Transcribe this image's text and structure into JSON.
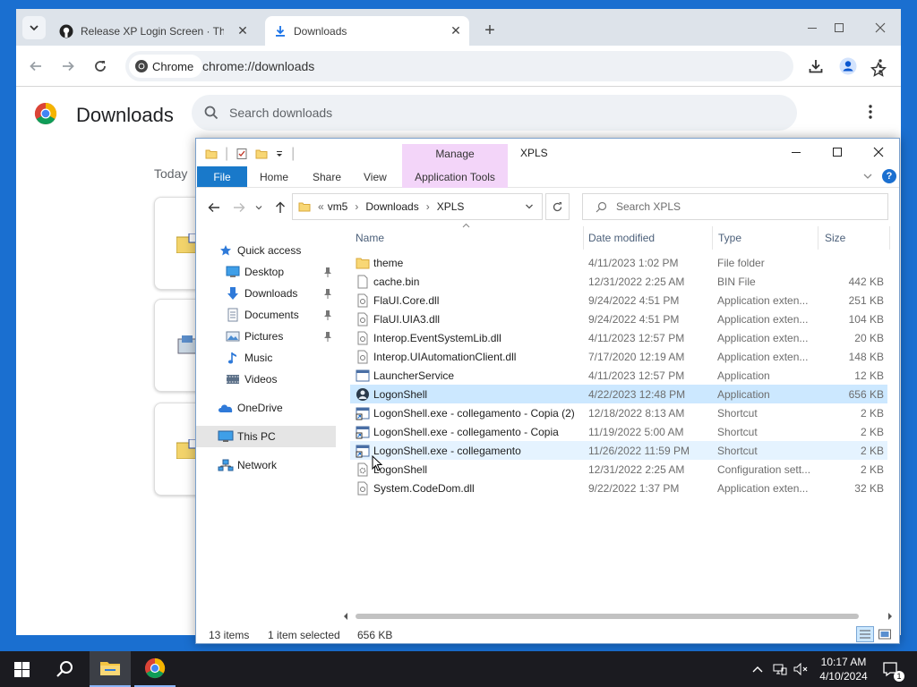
{
  "chrome": {
    "tabs": [
      {
        "title": "Release XP Login Screen · TheR"
      },
      {
        "title": "Downloads"
      }
    ],
    "omnibox": {
      "chip": "Chrome",
      "url": "chrome://downloads"
    },
    "page": {
      "title": "Downloads",
      "search_placeholder": "Search downloads",
      "section": "Today"
    }
  },
  "explorer": {
    "title": "XPLS",
    "contextual_tab": "Manage",
    "ribbon_tabs": [
      "File",
      "Home",
      "Share",
      "View",
      "Application Tools"
    ],
    "breadcrumb": [
      "vm5",
      "Downloads",
      "XPLS"
    ],
    "search_placeholder": "Search XPLS",
    "nav": [
      {
        "label": "Quick access",
        "icon": "star-icon"
      },
      {
        "label": "Desktop",
        "icon": "desktop-icon",
        "pinned": true
      },
      {
        "label": "Downloads",
        "icon": "download-arrow-icon",
        "pinned": true
      },
      {
        "label": "Documents",
        "icon": "documents-icon",
        "pinned": true
      },
      {
        "label": "Pictures",
        "icon": "pictures-icon",
        "pinned": true
      },
      {
        "label": "Music",
        "icon": "music-note-icon"
      },
      {
        "label": "Videos",
        "icon": "videos-icon"
      },
      {
        "label": "OneDrive",
        "icon": "cloud-icon"
      },
      {
        "label": "This PC",
        "icon": "computer-icon",
        "selected": true
      },
      {
        "label": "Network",
        "icon": "network-icon"
      }
    ],
    "columns": [
      "Name",
      "Date modified",
      "Type",
      "Size"
    ],
    "files": [
      {
        "name": "theme",
        "date": "4/11/2023 1:02 PM",
        "type": "File folder",
        "size": "",
        "icon": "folder-icon"
      },
      {
        "name": "cache.bin",
        "date": "12/31/2022 2:25 AM",
        "type": "BIN File",
        "size": "442 KB",
        "icon": "file-icon"
      },
      {
        "name": "FlaUI.Core.dll",
        "date": "9/24/2022 4:51 PM",
        "type": "Application exten...",
        "size": "251 KB",
        "icon": "dll-icon"
      },
      {
        "name": "FlaUI.UIA3.dll",
        "date": "9/24/2022 4:51 PM",
        "type": "Application exten...",
        "size": "104 KB",
        "icon": "dll-icon"
      },
      {
        "name": "Interop.EventSystemLib.dll",
        "date": "4/11/2023 12:57 PM",
        "type": "Application exten...",
        "size": "20 KB",
        "icon": "dll-icon"
      },
      {
        "name": "Interop.UIAutomationClient.dll",
        "date": "7/17/2020 12:19 AM",
        "type": "Application exten...",
        "size": "148 KB",
        "icon": "dll-icon"
      },
      {
        "name": "LauncherService",
        "date": "4/11/2023 12:57 PM",
        "type": "Application",
        "size": "12 KB",
        "icon": "app-icon"
      },
      {
        "name": "LogonShell",
        "date": "4/22/2023 12:48 PM",
        "type": "Application",
        "size": "656 KB",
        "icon": "logonshell-app-icon",
        "state": "selected"
      },
      {
        "name": "LogonShell.exe - collegamento - Copia (2)",
        "date": "12/18/2022 8:13 AM",
        "type": "Shortcut",
        "size": "2 KB",
        "icon": "shortcut-icon"
      },
      {
        "name": "LogonShell.exe - collegamento - Copia",
        "date": "11/19/2022 5:00 AM",
        "type": "Shortcut",
        "size": "2 KB",
        "icon": "shortcut-icon"
      },
      {
        "name": "LogonShell.exe - collegamento",
        "date": "11/26/2022 11:59 PM",
        "type": "Shortcut",
        "size": "2 KB",
        "icon": "shortcut-icon",
        "state": "hover"
      },
      {
        "name": "LogonShell",
        "date": "12/31/2022 2:25 AM",
        "type": "Configuration sett...",
        "size": "2 KB",
        "icon": "config-file-icon"
      },
      {
        "name": "System.CodeDom.dll",
        "date": "9/22/2022 1:37 PM",
        "type": "Application exten...",
        "size": "32 KB",
        "icon": "dll-icon"
      }
    ],
    "status": {
      "items": "13 items",
      "selected": "1 item selected",
      "size": "656 KB"
    }
  },
  "taskbar": {
    "time": "10:17 AM",
    "date": "4/10/2024",
    "notification_count": "1"
  },
  "colors": {
    "desktop": "#1a6fd0",
    "selection": "#cce8ff",
    "hover": "#e5f3ff",
    "manage_tab": "#f3d5f9",
    "file_tab": "#1979ca",
    "taskbar": "#1b1b20"
  }
}
